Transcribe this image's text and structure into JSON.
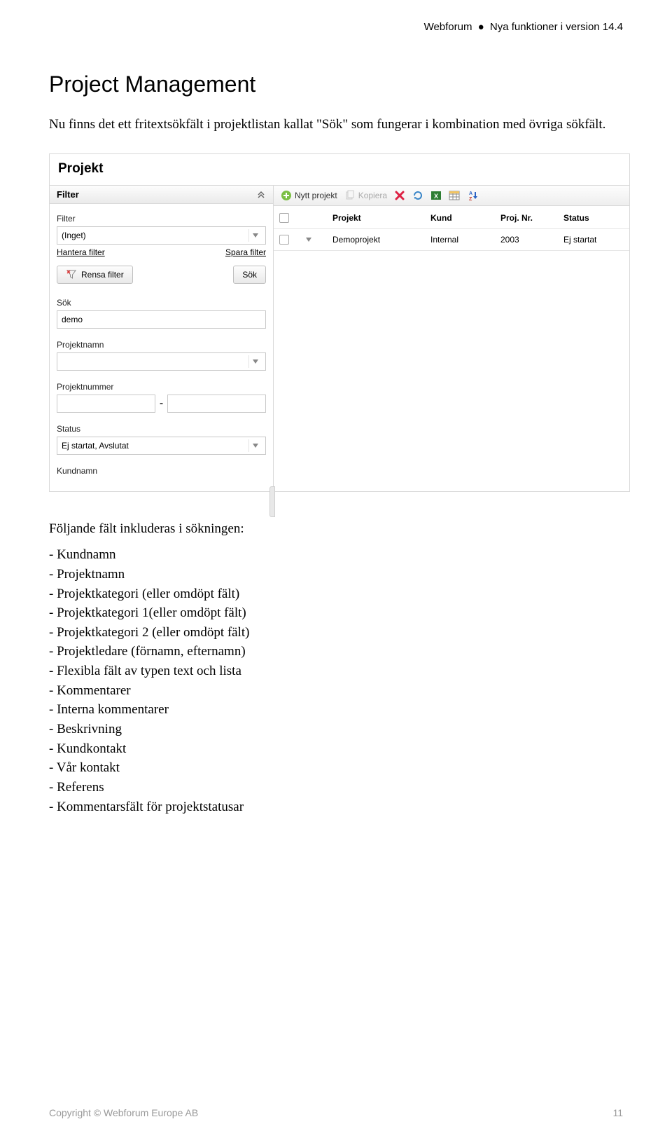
{
  "header": {
    "brand": "Webforum",
    "sep": "●",
    "rest": "Nya  funktioner i version 14.4"
  },
  "title": "Project Management",
  "intro": "Nu finns det ett fritextsökfält i projektlistan kallat \"Sök\" som fungerar i kombination med övriga sökfält.",
  "app": {
    "title": "Projekt",
    "sidebar": {
      "panel_label": "Filter",
      "filter_label": "Filter",
      "filter_value": "(Inget)",
      "manage_link": "Hantera filter",
      "save_link": "Spara filter",
      "clear_btn": "Rensa filter",
      "search_btn": "Sök",
      "search_label": "Sök",
      "search_value": "demo",
      "projname_label": "Projektnamn",
      "projname_value": "",
      "projnum_label": "Projektnummer",
      "projnum_from": "",
      "projnum_to": "",
      "projnum_sep": "-",
      "status_label": "Status",
      "status_value": "Ej startat, Avslutat",
      "kund_label": "Kundnamn"
    },
    "toolbar": {
      "new_project": "Nytt projekt",
      "copy": "Kopiera"
    },
    "cols": {
      "projekt": "Projekt",
      "kund": "Kund",
      "projnr": "Proj. Nr.",
      "status": "Status"
    },
    "row": {
      "projekt": "Demoprojekt",
      "kund": "Internal",
      "projnr": "2003",
      "status": "Ej startat"
    }
  },
  "post": {
    "lead": "Följande fält inkluderas i sökningen:",
    "items": [
      "- Kundnamn",
      "- Projektnamn",
      "- Projektkategori  (eller omdöpt fält)",
      "- Projektkategori 1(eller omdöpt fält)",
      "- Projektkategori 2 (eller omdöpt fält)",
      "- Projektledare (förnamn, efternamn)",
      "- Flexibla fält av typen text och lista",
      "- Kommentarer",
      "- Interna kommentarer",
      "- Beskrivning",
      "- Kundkontakt",
      "- Vår kontakt",
      "- Referens",
      "- Kommentarsfält för projektstatusar"
    ]
  },
  "footer": {
    "copyright": "Copyright © Webforum Europe AB",
    "page": "11"
  }
}
